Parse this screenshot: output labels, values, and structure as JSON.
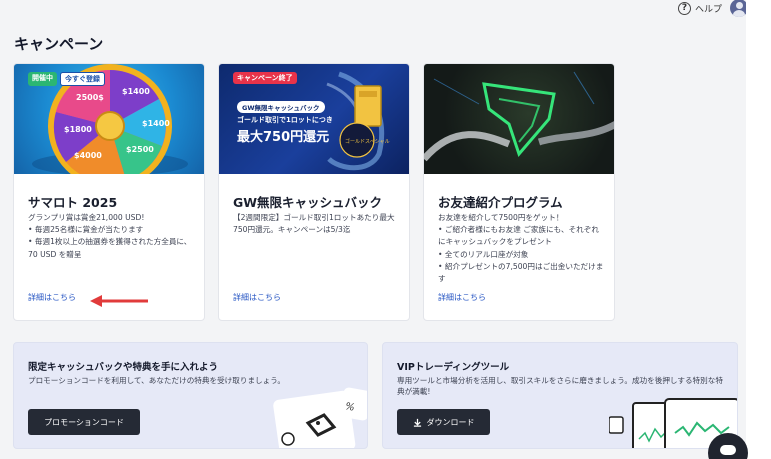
{
  "header": {
    "help_label": "ヘルプ",
    "help_icon": "question-circle-icon",
    "avatar_icon": "user-avatar-icon"
  },
  "page": {
    "title": "キャンペーン"
  },
  "cards": [
    {
      "badges": [
        "開催中",
        "今すぐ登録"
      ],
      "title": "サマロト 2025",
      "description": "グランプリ賞は賞金21,000 USD!\n• 毎週25名様に賞金が当たります\n• 毎週1枚以上の抽選券を獲得された方全員に、70 USD を贈呈",
      "link": "詳細はこちら",
      "wheel_labels": [
        "$1400",
        "$1400",
        "$2500",
        "$4000",
        "$1800",
        "2500$"
      ]
    },
    {
      "badges": [
        "キャンペーン終了"
      ],
      "title": "GW無限キャッシュバック",
      "description": "【2週間限定】ゴールド取引1ロットあたり最大750円還元。キャンペーンは5/3迄",
      "link": "詳細はこちら",
      "banner": {
        "pill": "GW無限キャッシュバック",
        "sub": "ゴールド取引で1ロットにつき",
        "headline": "最大750円還元",
        "disc": "ゴールドスペシャル"
      }
    },
    {
      "badges": [],
      "title": "お友達紹介プログラム",
      "description": "お友達を紹介して7500円をゲット！\n• ご紹介者様にもお友達 ご家族にも、それぞれにキャッシュバックをプレゼント\n• 全てのリアル口座が対象\n• 紹介プレゼントの7,500円はご出金いただけます",
      "link": "詳細はこちら"
    }
  ],
  "promos": [
    {
      "title": "限定キャッシュバックや特典を手に入れよう",
      "description": "プロモーションコードを利用して、あなただけの特典を受け取りましょう。",
      "button": "プロモーションコード"
    },
    {
      "title": "VIPトレーディングツール",
      "description": "専用ツールと市場分析を活用し、取引スキルをさらに磨きましょう。成功を後押しする特別な特典が満載!",
      "button": "ダウンロード",
      "button_icon": "download-icon"
    }
  ],
  "colors": {
    "link": "#2a58c4",
    "accent_red": "#e8334a",
    "badge_green": "#2bb673",
    "dark_button": "#252a35"
  }
}
